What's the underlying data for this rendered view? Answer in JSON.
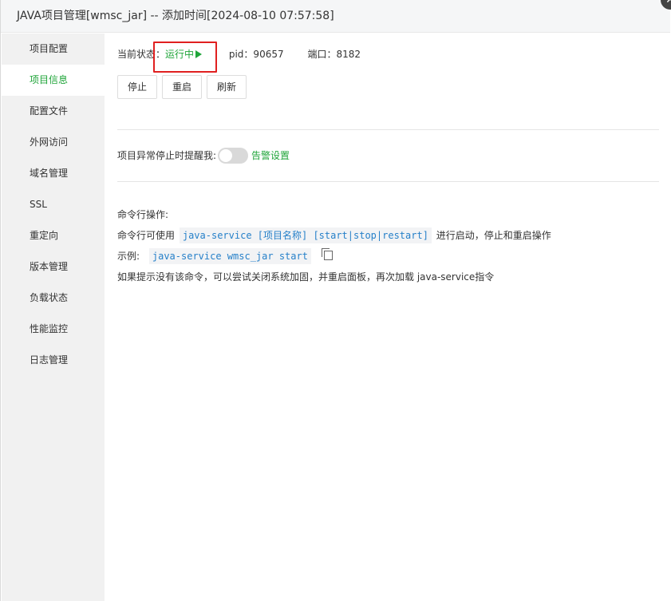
{
  "window": {
    "title": "JAVA项目管理[wmsc_jar] -- 添加时间[2024-08-10 07:57:58]",
    "close_glyph": "✕"
  },
  "sidebar": {
    "items": [
      {
        "label": "项目配置"
      },
      {
        "label": "项目信息"
      },
      {
        "label": "配置文件"
      },
      {
        "label": "外网访问"
      },
      {
        "label": "域名管理"
      },
      {
        "label": "SSL"
      },
      {
        "label": "重定向"
      },
      {
        "label": "版本管理"
      },
      {
        "label": "负载状态"
      },
      {
        "label": "性能监控"
      },
      {
        "label": "日志管理"
      }
    ]
  },
  "status": {
    "label": "当前状态：",
    "value": "运行中",
    "pid": "pid：90657",
    "port": "端口：8182"
  },
  "buttons": {
    "stop": "停止",
    "restart": "重启",
    "refresh": "刷新"
  },
  "alert": {
    "label": "项目异常停止时提醒我:",
    "link": "告警设置"
  },
  "cmd": {
    "title": "命令行操作:",
    "usage_prefix": "命令行可使用",
    "usage_code": "java-service [项目名称] [start|stop|restart]",
    "usage_suffix": "进行启动，停止和重启操作",
    "example_label": "示例:",
    "example_code": "java-service wmsc_jar start",
    "hint": "如果提示没有该命令，可以尝试关闭系统加固，并重启面板，再次加载 java-service指令"
  },
  "colors": {
    "accent": "#20a53a",
    "highlight": "#e02020",
    "code": "#2680c9"
  }
}
